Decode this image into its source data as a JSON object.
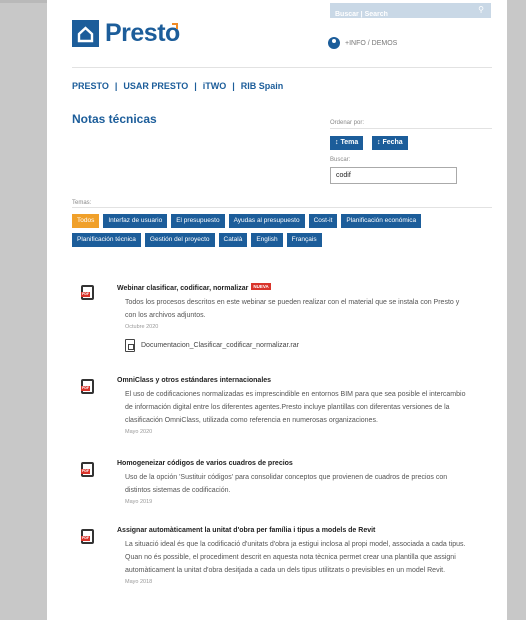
{
  "header": {
    "search_placeholder": "Buscar | Search",
    "logo_text": "Presto",
    "info_label": "+INFO / DEMOS"
  },
  "nav": {
    "items": [
      "PRESTO",
      "USAR PRESTO",
      "iTWO",
      "RIB Spain"
    ],
    "separator": "|"
  },
  "page_title": "Notas técnicas",
  "sort": {
    "label": "Ordenar por:",
    "tema": "↕ Tema",
    "fecha": "↕ Fecha"
  },
  "search": {
    "label": "Buscar:",
    "value": "codif"
  },
  "temas": {
    "label": "Temas:",
    "tags": [
      "Todos",
      "Interfaz de usuario",
      "El presupuesto",
      "Ayudas al presupuesto",
      "Cost-it",
      "Planificación económica",
      "Planificación técnica",
      "Gestión del proyecto",
      "Català",
      "English",
      "Français"
    ]
  },
  "items": [
    {
      "title": "Webinar clasificar, codificar, normalizar",
      "badge": "NUEVA",
      "desc": "Todos los procesos descritos en este webinar se pueden realizar con el material que se instala con Presto y con los archivos adjuntos.",
      "date": "Octubre 2020",
      "attachment": "Documentacion_Clasificar_codificar_normalizar.rar"
    },
    {
      "title": "OmniClass y otros estándares internacionales",
      "desc": "El uso de codificaciones normalizadas es imprescindible en entornos BIM para que sea posible el intercambio de información digital entre los diferentes agentes.Presto incluye plantillas con diferentas versiones de la clasificación OmniClass, utilizada como referencia en numerosas organizaciones.",
      "date": "Mayo 2020"
    },
    {
      "title": "Homogeneizar códigos de varios cuadros de precios",
      "desc": "Uso de la opción 'Sustituir códigos' para consolidar conceptos que provienen de cuadros de precios con distintos sistemas de codificación.",
      "date": "Mayo 2019"
    },
    {
      "title": "Assignar automàticament la unitat d'obra per família i tipus a models de Revit",
      "desc": "La situació ideal és que la codificació d'unitats d'obra ja estigui inclosa al propi model, associada a cada tipus. Quan no és possible, el procediment descrit en aquesta nota tècnica permet crear una plantilla que assigni automàticament la unitat d'obra desitjada a cada un dels tipus utilitzats o previsibles en un model Revit.",
      "date": "Mayo 2018"
    }
  ],
  "pdf_label": "PDF",
  "colors": {
    "brand": "#1c5d9a",
    "accent": "#f0a02a",
    "badge": "#d9342b"
  }
}
